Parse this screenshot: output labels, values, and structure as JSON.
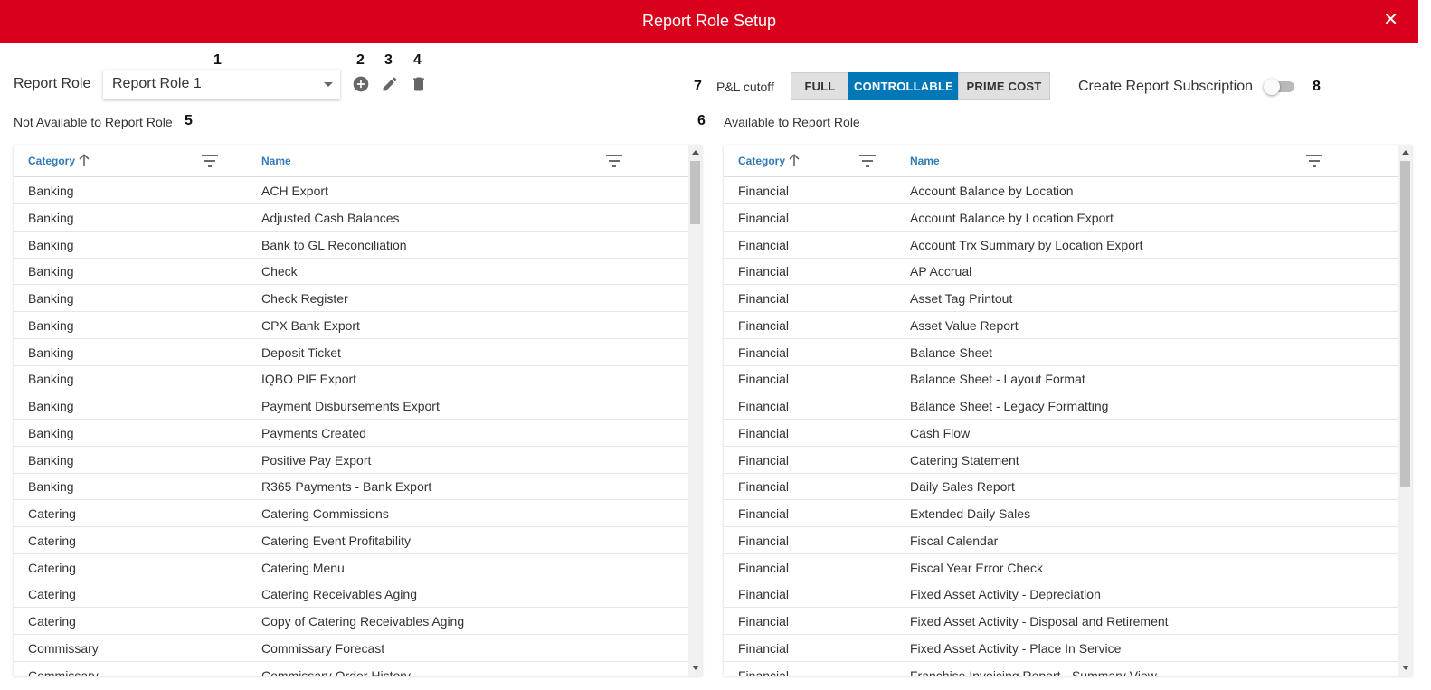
{
  "window": {
    "title": "Report Role Setup",
    "close_icon": "close-icon",
    "accent": "#d9001b"
  },
  "callouts": [
    "1",
    "2",
    "3",
    "4",
    "5",
    "6",
    "7",
    "8"
  ],
  "role": {
    "label": "Report Role",
    "selected": "Report Role 1"
  },
  "actions": {
    "add_icon": "plus-circle-icon",
    "edit_icon": "pencil-icon",
    "delete_icon": "trash-icon"
  },
  "pl_cutoff": {
    "label": "P&L cutoff",
    "options": [
      "FULL",
      "CONTROLLABLE",
      "PRIME COST"
    ],
    "selected": "CONTROLLABLE",
    "selected_color": "#0077b6"
  },
  "subscription": {
    "label": "Create Report Subscription",
    "enabled": false
  },
  "not_available": {
    "title": "Not Available to Report Role",
    "columns": {
      "category": "Category",
      "name": "Name"
    },
    "sort": "Category ascending",
    "rows": [
      [
        "Banking",
        "ACH Export"
      ],
      [
        "Banking",
        "Adjusted Cash Balances"
      ],
      [
        "Banking",
        "Bank to GL Reconciliation"
      ],
      [
        "Banking",
        "Check"
      ],
      [
        "Banking",
        "Check Register"
      ],
      [
        "Banking",
        "CPX Bank Export"
      ],
      [
        "Banking",
        "Deposit Ticket"
      ],
      [
        "Banking",
        "IQBO PIF Export"
      ],
      [
        "Banking",
        "Payment Disbursements Export"
      ],
      [
        "Banking",
        "Payments Created"
      ],
      [
        "Banking",
        "Positive Pay Export"
      ],
      [
        "Banking",
        "R365 Payments - Bank Export"
      ],
      [
        "Catering",
        "Catering Commissions"
      ],
      [
        "Catering",
        "Catering Event Profitability"
      ],
      [
        "Catering",
        "Catering Menu"
      ],
      [
        "Catering",
        "Catering Receivables Aging"
      ],
      [
        "Catering",
        "Copy of Catering Receivables Aging"
      ],
      [
        "Commissary",
        "Commissary Forecast"
      ],
      [
        "Commissary",
        "Commissary Order History"
      ]
    ]
  },
  "available": {
    "title": "Available to Report Role",
    "columns": {
      "category": "Category",
      "name": "Name"
    },
    "sort": "Category ascending",
    "rows": [
      [
        "Financial",
        "Account Balance by Location"
      ],
      [
        "Financial",
        "Account Balance by Location Export"
      ],
      [
        "Financial",
        "Account Trx Summary by Location Export"
      ],
      [
        "Financial",
        "AP Accrual"
      ],
      [
        "Financial",
        "Asset Tag Printout"
      ],
      [
        "Financial",
        "Asset Value Report"
      ],
      [
        "Financial",
        "Balance Sheet"
      ],
      [
        "Financial",
        "Balance Sheet - Layout Format"
      ],
      [
        "Financial",
        "Balance Sheet - Legacy Formatting"
      ],
      [
        "Financial",
        "Cash Flow"
      ],
      [
        "Financial",
        "Catering Statement"
      ],
      [
        "Financial",
        "Daily Sales Report"
      ],
      [
        "Financial",
        "Extended Daily Sales"
      ],
      [
        "Financial",
        "Fiscal Calendar"
      ],
      [
        "Financial",
        "Fiscal Year Error Check"
      ],
      [
        "Financial",
        "Fixed Asset Activity - Depreciation"
      ],
      [
        "Financial",
        "Fixed Asset Activity - Disposal and Retirement"
      ],
      [
        "Financial",
        "Fixed Asset Activity - Place In Service"
      ],
      [
        "Financial",
        "Franchise Invoicing Report - Summary View"
      ]
    ]
  }
}
